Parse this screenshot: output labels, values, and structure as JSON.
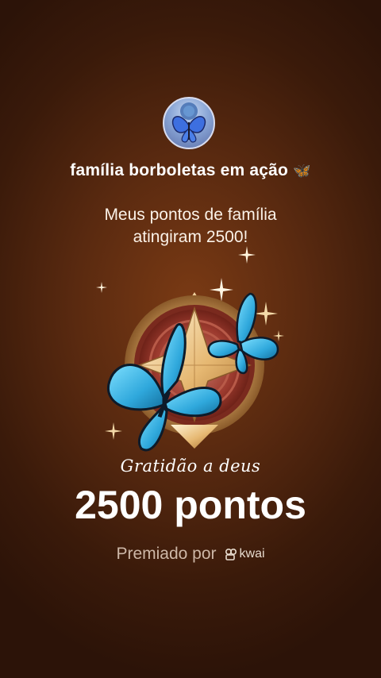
{
  "family": {
    "name": "família  borboletas em ação",
    "emoji": "🦋"
  },
  "headline": {
    "line1": "Meus pontos de família",
    "line2": "atingiram 2500!"
  },
  "badge": {
    "caption": "Gratidão  a deus"
  },
  "points": {
    "text": "2500 pontos"
  },
  "awarded": {
    "label": "Premiado por",
    "brand": "kwai"
  },
  "colors": {
    "background": "#5a2a10",
    "butterfly": "#36b6e6",
    "gold": "#e8c27a"
  }
}
